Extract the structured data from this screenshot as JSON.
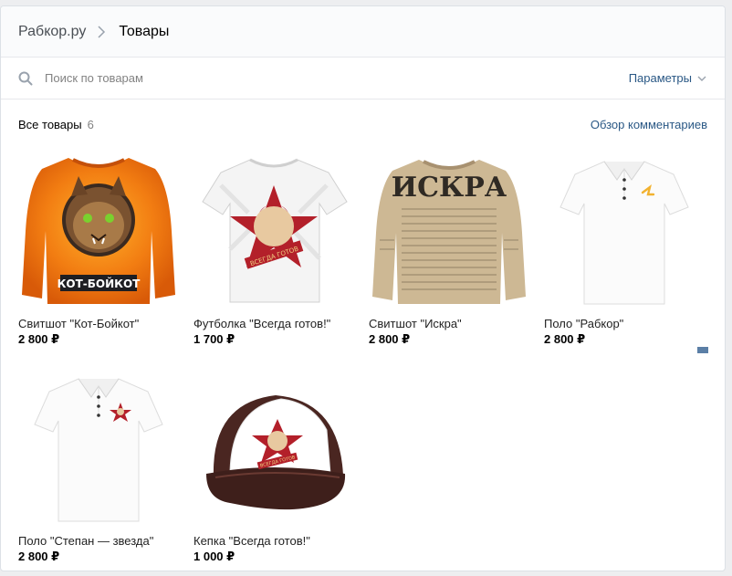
{
  "breadcrumb": {
    "group": "Рабкор.ру",
    "current": "Товары"
  },
  "search": {
    "placeholder": "Поиск по товарам",
    "params_label": "Параметры"
  },
  "section": {
    "title": "Все товары",
    "count": "6",
    "comments_link": "Обзор комментариев"
  },
  "products": [
    {
      "name": "Свитшот \"Кот-Бойкот\"",
      "price": "2 800 ₽",
      "image_text": "КОТ-БОЙКОТ"
    },
    {
      "name": "Футболка \"Всегда готов!\"",
      "price": "1 700 ₽",
      "image_text": "ВСЕГДА ГОТОВ"
    },
    {
      "name": "Свитшот \"Искра\"",
      "price": "2 800 ₽",
      "image_text": "ИСКРА"
    },
    {
      "name": "Поло \"Рабкор\"",
      "price": "2 800 ₽"
    },
    {
      "name": "Поло \"Степан — звезда\"",
      "price": "2 800 ₽"
    },
    {
      "name": "Кепка \"Всегда готов!\"",
      "price": "1 000 ₽",
      "image_text": "ВСЕГДА ГОТОВ"
    }
  ],
  "colors": {
    "link": "#2a5885",
    "orange": "#f0700f",
    "red_star": "#b3202a",
    "cap_brown": "#4a2621"
  }
}
